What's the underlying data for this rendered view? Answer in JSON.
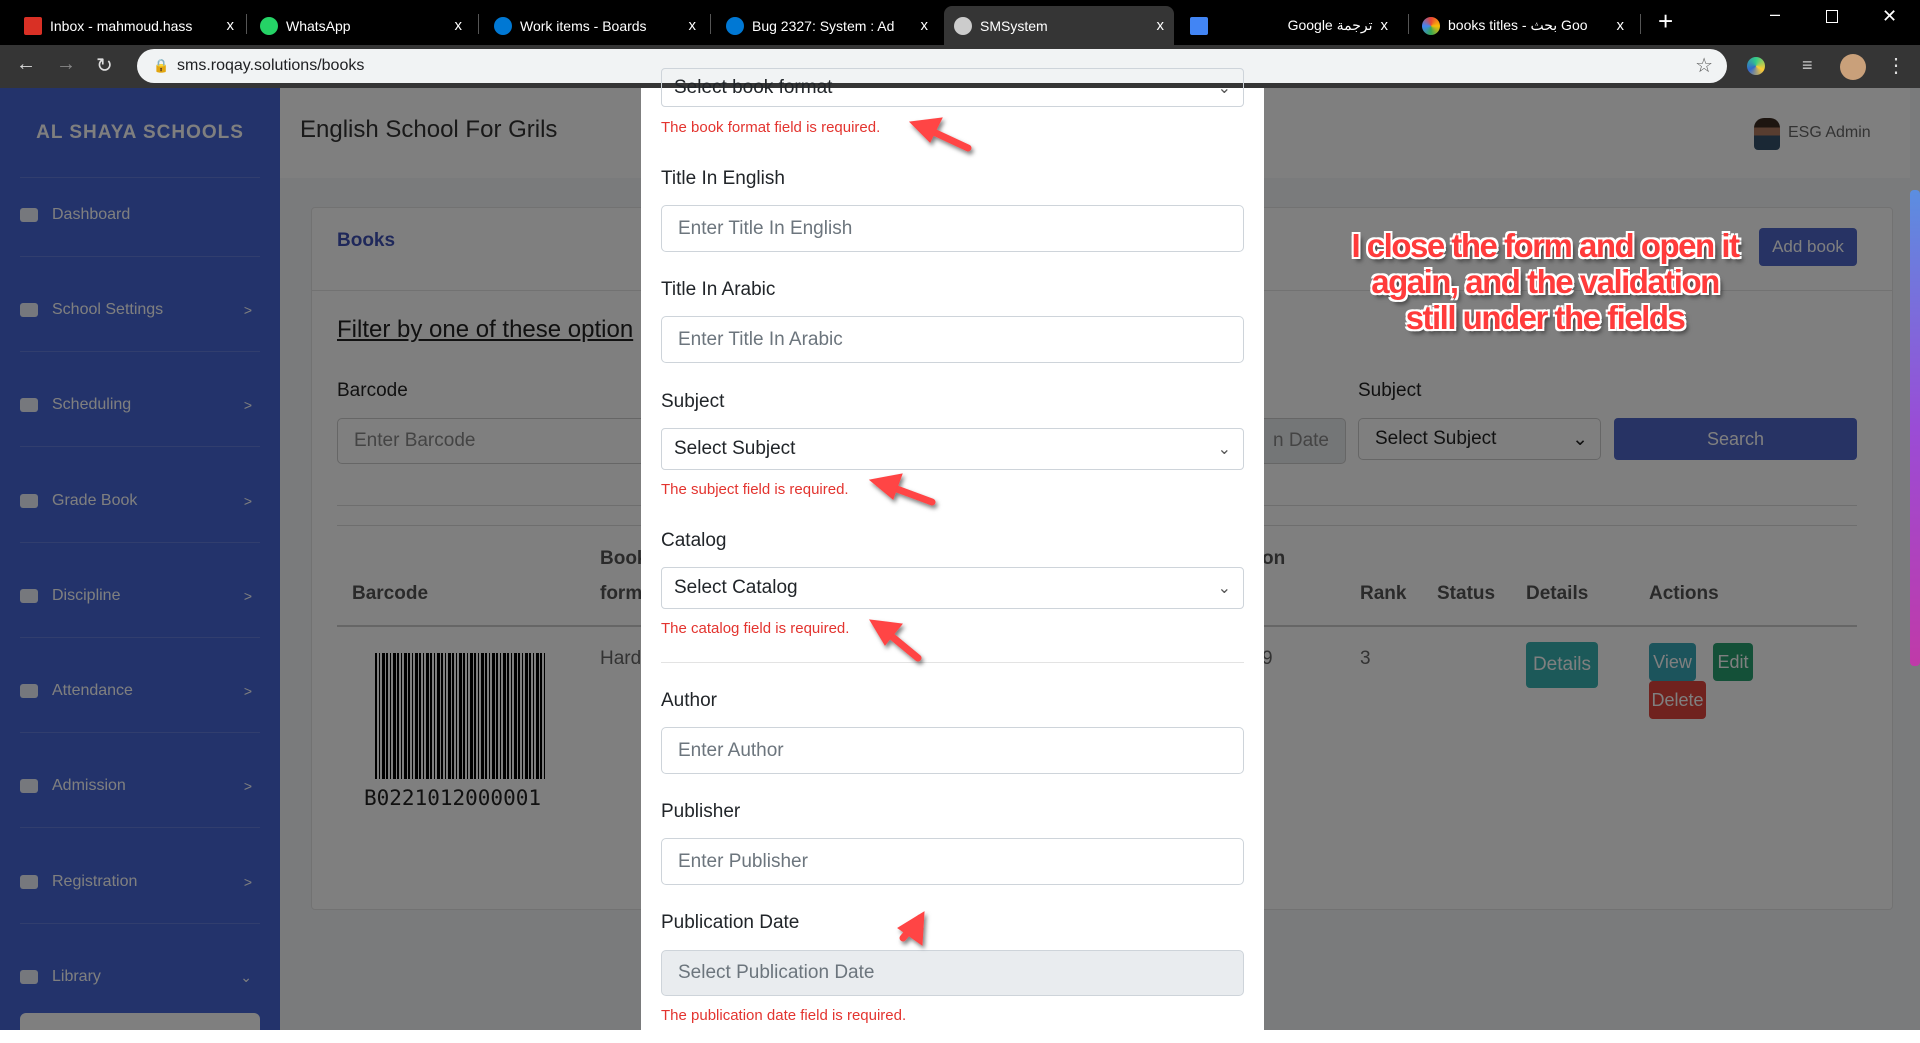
{
  "browser": {
    "tabs": [
      {
        "label": "Inbox - mahmoud.hass",
        "color": "#d93025"
      },
      {
        "label": "WhatsApp",
        "color": "#25d366"
      },
      {
        "label": "Work items - Boards",
        "color": "#0078d4"
      },
      {
        "label": "Bug 2327: System : Ad",
        "color": "#0078d4"
      },
      {
        "label": "SMSystem",
        "color": "#cccccc"
      },
      {
        "label": "Google ترجمة",
        "color": "#4285f4"
      },
      {
        "label": "books titles - بحث Goo",
        "color": "#ea4335"
      }
    ],
    "new_tab": "+",
    "url": "sms.roqay.solutions/books",
    "close_glyph": "x"
  },
  "sidebar": {
    "brand": "AL SHAYA SCHOOLS",
    "items": [
      {
        "label": "Dashboard",
        "icon": "dashboard-icon",
        "chev": ""
      },
      {
        "label": "School Settings",
        "icon": "gear-icon",
        "chev": ">"
      },
      {
        "label": "Scheduling",
        "icon": "table-icon",
        "chev": ">"
      },
      {
        "label": "Grade Book",
        "icon": "book-icon",
        "chev": ">"
      },
      {
        "label": "Discipline",
        "icon": "face-icon",
        "chev": ">"
      },
      {
        "label": "Attendance",
        "icon": "book-icon",
        "chev": ">"
      },
      {
        "label": "Admission",
        "icon": "user-icon",
        "chev": ">"
      },
      {
        "label": "Registration",
        "icon": "user-lock-icon",
        "chev": ">"
      },
      {
        "label": "Library",
        "icon": "book-icon",
        "chev": "⌄"
      }
    ]
  },
  "header": {
    "school": "English School For Grils",
    "user": "ESG Admin"
  },
  "books": {
    "title": "Books",
    "add": "Add book",
    "filter_title": "Filter by one of these option",
    "barcode_label": "Barcode",
    "barcode_placeholder": "Enter Barcode",
    "date_tail": "n Date",
    "subject_label": "Subject",
    "subject_select": "Select Subject",
    "search": "Search",
    "columns": {
      "barcode": "Barcode",
      "book": "Book",
      "form": "form",
      "pub_tail": "on",
      "rank": "Rank",
      "status": "Status",
      "details": "Details",
      "actions": "Actions"
    },
    "row": {
      "barcode": "B0221012000001",
      "format": "Hard",
      "date_tail": "9",
      "rank": "3",
      "details_btn": "Details",
      "view": "View",
      "edit": "Edit",
      "delete": "Delete"
    }
  },
  "modal": {
    "format_select": "Select book format",
    "format_error": "The book format field is required.",
    "title_en_label": "Title In English",
    "title_en_ph": "Enter Title In English",
    "title_ar_label": "Title In Arabic",
    "title_ar_ph": "Enter Title In Arabic",
    "subject_label": "Subject",
    "subject_select": "Select Subject",
    "subject_error": "The subject field is required.",
    "catalog_label": "Catalog",
    "catalog_select": "Select Catalog",
    "catalog_error": "The catalog field is required.",
    "author_label": "Author",
    "author_ph": "Enter Author",
    "publisher_label": "Publisher",
    "publisher_ph": "Enter Publisher",
    "pubdate_label": "Publication Date",
    "pubdate_ph": "Select Publication Date",
    "pubdate_error": "The publication date field is required."
  },
  "annotation": "I close the form and open it again, and the validation still under the fields"
}
